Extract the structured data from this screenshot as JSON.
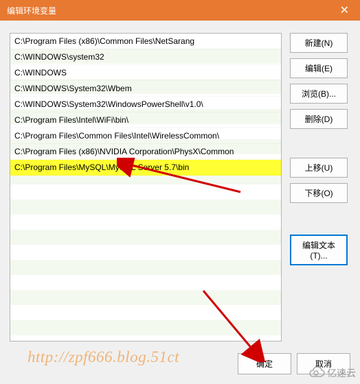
{
  "window": {
    "title": "编辑环境变量"
  },
  "list": {
    "items": [
      {
        "value": "C:\\Program Files (x86)\\Common Files\\NetSarang",
        "highlighted": false
      },
      {
        "value": "C:\\WINDOWS\\system32",
        "highlighted": false
      },
      {
        "value": "C:\\WINDOWS",
        "highlighted": false
      },
      {
        "value": "C:\\WINDOWS\\System32\\Wbem",
        "highlighted": false
      },
      {
        "value": "C:\\WINDOWS\\System32\\WindowsPowerShell\\v1.0\\",
        "highlighted": false
      },
      {
        "value": "C:\\Program Files\\Intel\\WiFi\\bin\\",
        "highlighted": false
      },
      {
        "value": "C:\\Program Files\\Common Files\\Intel\\WirelessCommon\\",
        "highlighted": false
      },
      {
        "value": "C:\\Program Files (x86)\\NVIDIA Corporation\\PhysX\\Common",
        "highlighted": false
      },
      {
        "value": "C:\\Program Files\\MySQL\\MySQL Server 5.7\\bin",
        "highlighted": true
      }
    ]
  },
  "buttons": {
    "new": "新建(N)",
    "edit": "编辑(E)",
    "browse": "浏览(B)...",
    "delete": "删除(D)",
    "moveup": "上移(U)",
    "movedown": "下移(O)",
    "edittext": "编辑文本(T)...",
    "ok": "确定",
    "cancel": "取消"
  },
  "watermark": {
    "url": "http://zpf666.blog.51ct",
    "logo_text": "亿速云"
  }
}
